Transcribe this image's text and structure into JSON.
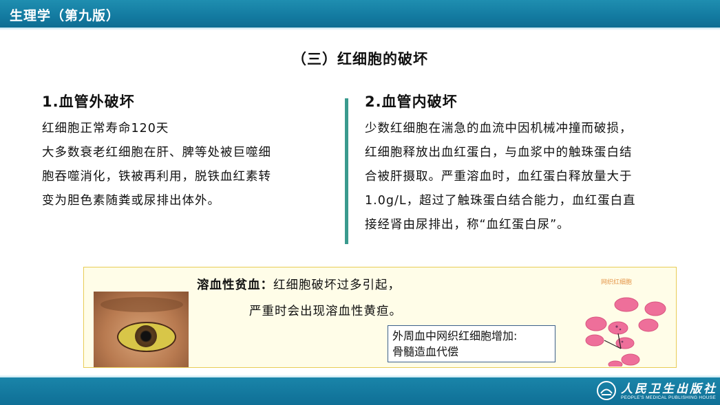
{
  "header": {
    "book_title": "生理学（第九版）"
  },
  "slide": {
    "title": "（三）红细胞的破坏"
  },
  "left_section": {
    "heading": "1.血管外破坏",
    "lines": [
      "红细胞正常寿命120天",
      "大多数衰老红细胞在肝、脾等处被巨噬细",
      "胞吞噬消化，铁被再利用，脱铁血红素转",
      "变为胆色素随粪或尿排出体外。"
    ]
  },
  "right_section": {
    "heading": "2.血管内破坏",
    "lines": [
      "少数红细胞在湍急的血流中因机械冲撞而破损，",
      "红细胞释放出血红蛋白，与血浆中的触珠蛋白结",
      "合被肝摄取。严重溶血时，血红蛋白释放量大于",
      "1.0g/L，超过了触珠蛋白结合能力，血红蛋白直",
      "接经肾由尿排出，称“血红蛋白尿”。"
    ]
  },
  "info_box": {
    "term": "溶血性贫血：",
    "line1_rest": "红细胞破坏过多引起，",
    "line2": "严重时会出现溶血性黄疸。",
    "note_line1": "外周血中网织红细胞增加:",
    "note_line2": "骨髓造血代偿",
    "figure_caption": "网织红细胞"
  },
  "footer": {
    "publisher_cn": "人民卫生出版社",
    "publisher_en": "PEOPLE'S MEDICAL PUBLISHING HOUSE"
  },
  "colors": {
    "header_bar": "#137aa0",
    "divider": "#3a9a8e",
    "box_border": "#e8cc55",
    "box_fill": "#fffde8",
    "note_border": "#3b5f8a",
    "rbc_pink": "#ee6f9a"
  }
}
